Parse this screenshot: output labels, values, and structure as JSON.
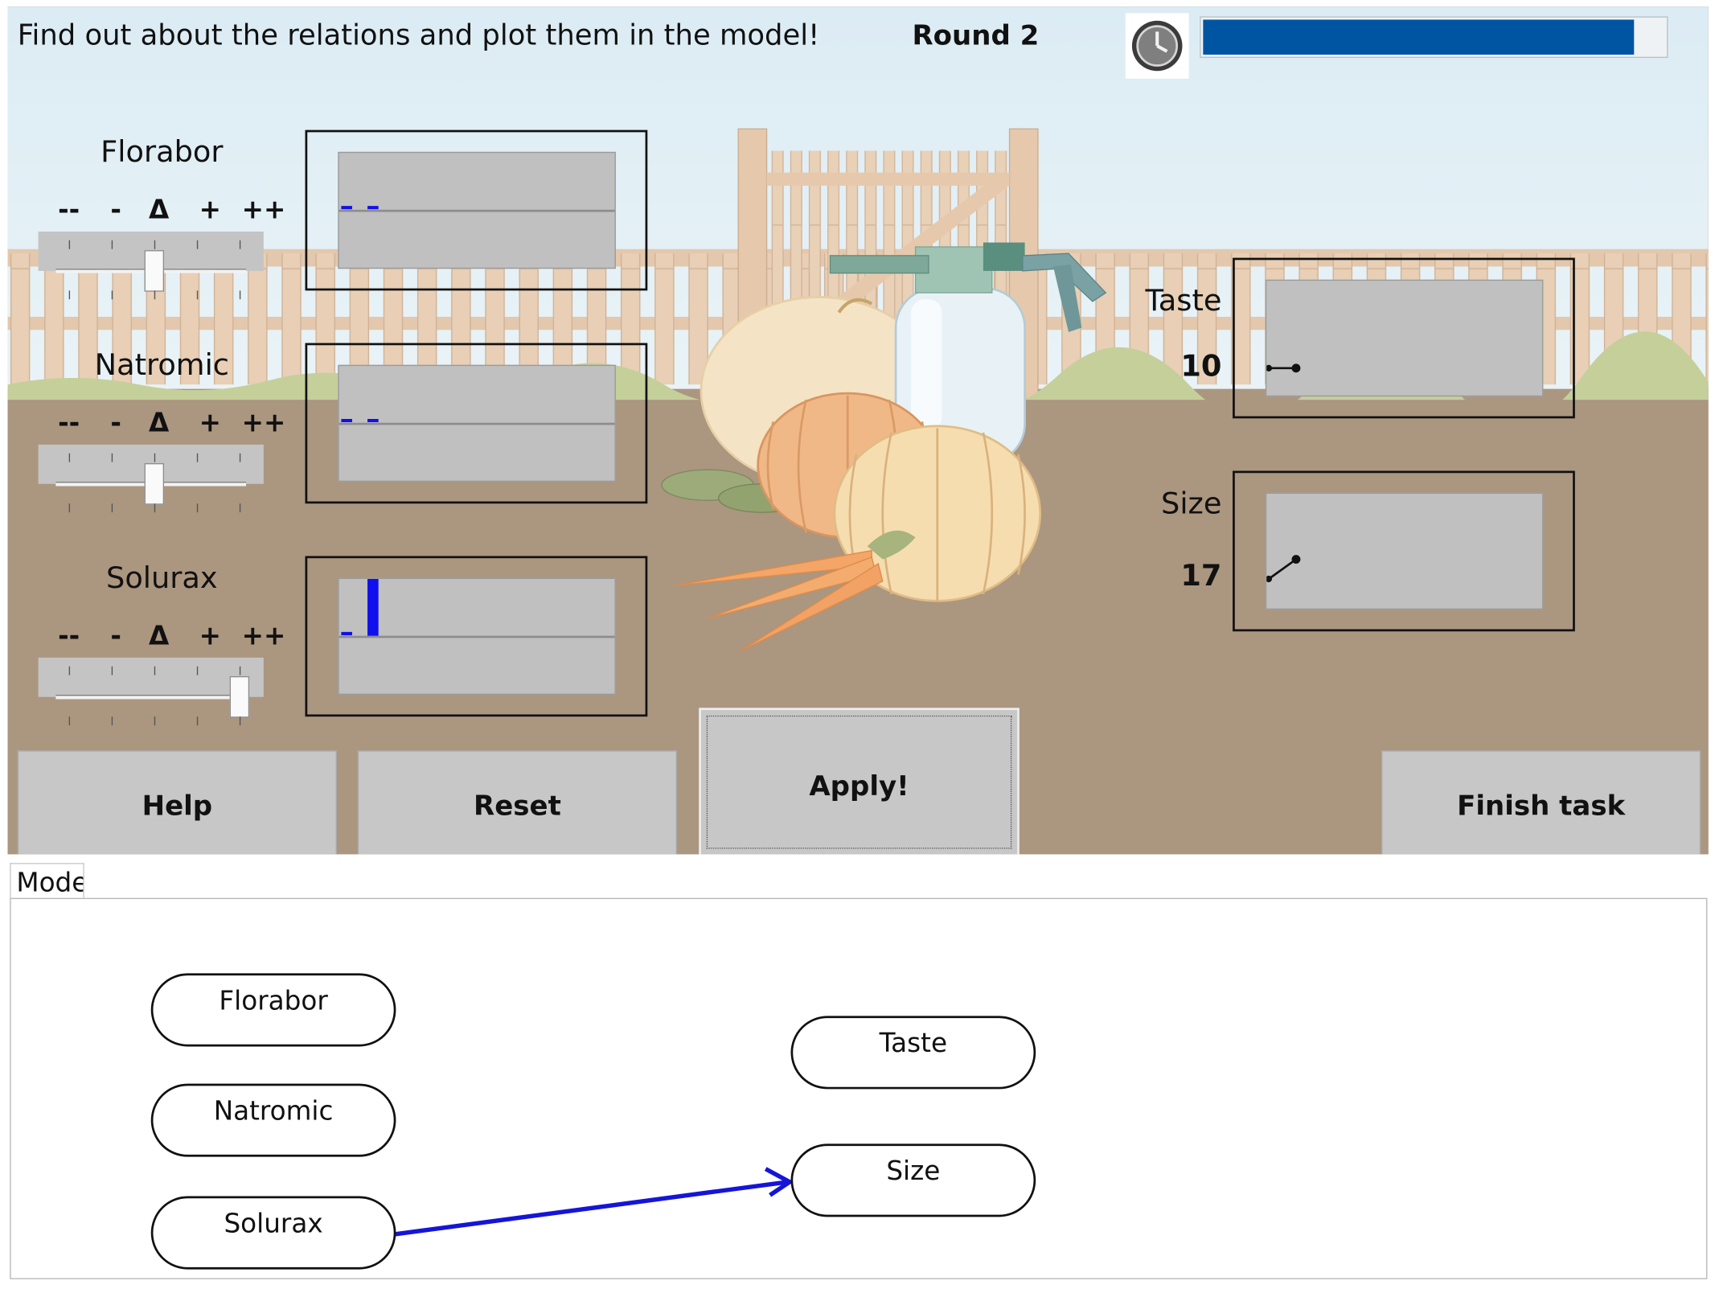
{
  "header": {
    "instruction": "Find out about the relations and plot them in the model!",
    "round": "Round 2",
    "timer_icon": "clock-icon",
    "time_remaining_fraction": 0.93
  },
  "scale_labels": [
    "--",
    "-",
    "Δ",
    "+",
    "++"
  ],
  "inputs": [
    {
      "name": "Florabor",
      "slider_level": 2
    },
    {
      "name": "Natromic",
      "slider_level": 2
    },
    {
      "name": "Solurax",
      "slider_level": 4
    }
  ],
  "outputs": [
    {
      "name": "Taste",
      "value": "10"
    },
    {
      "name": "Size",
      "value": "17"
    }
  ],
  "buttons": {
    "help": "Help",
    "reset": "Reset",
    "apply": "Apply!",
    "finish": "Finish task"
  },
  "model": {
    "tab_label": "Model",
    "nodes": {
      "florabor": "Florabor",
      "natromic": "Natromic",
      "solurax": "Solurax",
      "taste": "Taste",
      "size": "Size"
    },
    "edges": [
      {
        "from": "Solurax",
        "to": "Size"
      }
    ]
  },
  "colors": {
    "progress": "#0055a2",
    "effect_bar": "#1010ee",
    "model_arrow": "#1515d8"
  }
}
